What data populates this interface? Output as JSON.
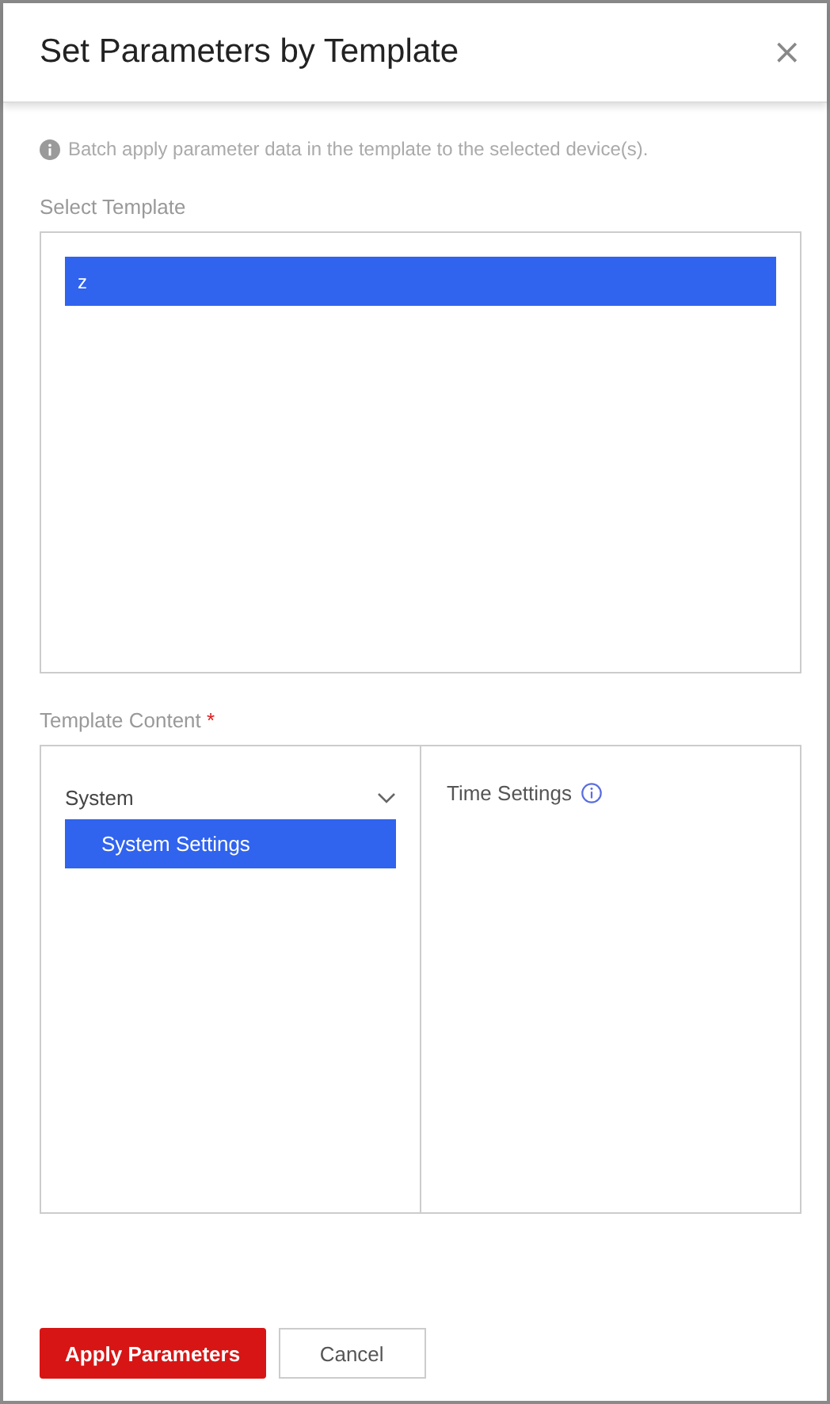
{
  "dialog": {
    "title": "Set Parameters by Template",
    "close_label": "×"
  },
  "hint": "Batch apply parameter data in the template to the selected device(s).",
  "select_template": {
    "label": "Select Template",
    "items": [
      {
        "name": "z",
        "selected": true
      }
    ]
  },
  "template_content": {
    "label": "Template Content",
    "required_mark": "*",
    "tree": [
      {
        "name": "System",
        "expanded": true,
        "children": [
          {
            "name": "System Settings",
            "selected": true
          }
        ]
      }
    ],
    "details": [
      {
        "name": "Time Settings",
        "has_info": true
      }
    ]
  },
  "buttons": [
    {
      "label": "Apply Parameters",
      "kind": "primary"
    },
    {
      "label": "Cancel",
      "kind": "secondary"
    }
  ]
}
